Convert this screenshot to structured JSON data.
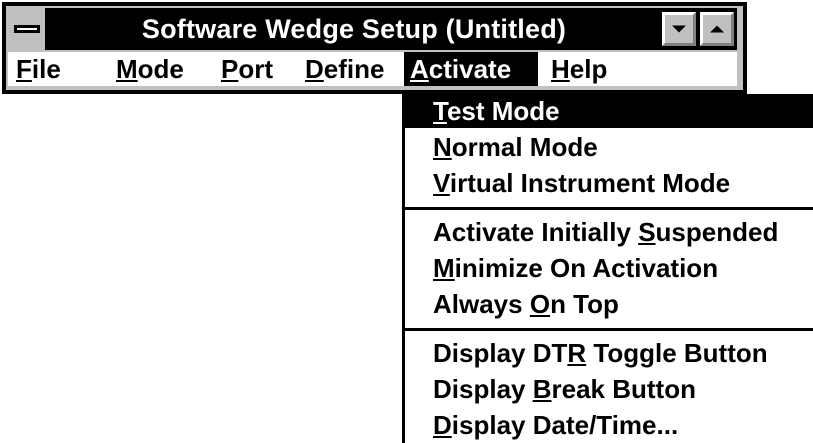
{
  "window": {
    "title": "Software Wedge Setup (Untitled)"
  },
  "title_bar": {
    "system_menu_icon": "system-menu-icon",
    "minimize_icon": "minimize-arrow-icon",
    "maximize_icon": "maximize-arrow-icon"
  },
  "menu_bar": {
    "items": [
      {
        "accel": "F",
        "rest": "ile"
      },
      {
        "accel": "M",
        "rest": "ode"
      },
      {
        "accel": "P",
        "rest": "ort"
      },
      {
        "accel": "D",
        "rest": "efine"
      },
      {
        "accel": "A",
        "rest": "ctivate",
        "active": true
      },
      {
        "accel": "H",
        "rest": "elp"
      }
    ]
  },
  "activate_menu": {
    "groups": [
      [
        {
          "pre": "",
          "accel": "T",
          "post": "est Mode",
          "selected": true
        },
        {
          "pre": "",
          "accel": "N",
          "post": "ormal Mode"
        },
        {
          "pre": "",
          "accel": "V",
          "post": "irtual Instrument Mode"
        }
      ],
      [
        {
          "pre": "Activate Initially ",
          "accel": "S",
          "post": "uspended"
        },
        {
          "pre": "",
          "accel": "M",
          "post": "inimize On Activation"
        },
        {
          "pre": "Always ",
          "accel": "O",
          "post": "n Top"
        }
      ],
      [
        {
          "pre": "Display DT",
          "accel": "R",
          "post": " Toggle Button"
        },
        {
          "pre": "Display ",
          "accel": "B",
          "post": "reak Button"
        },
        {
          "pre": "",
          "accel": "D",
          "post": "isplay Date/Time..."
        }
      ]
    ]
  },
  "colors": {
    "title_bar": "#000000",
    "title_text": "#ffffff",
    "highlight": "#000000",
    "highlight_text": "#ffffff",
    "frame": "#c0c0c0"
  }
}
